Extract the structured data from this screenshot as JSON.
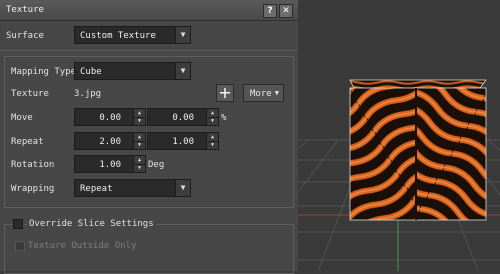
{
  "window": {
    "title": "Texture",
    "help_label": "?",
    "close_label": "✕"
  },
  "surface": {
    "label": "Surface",
    "value": "Custom Texture"
  },
  "mapping": {
    "label": "Mapping Type",
    "value": "Cube"
  },
  "texture": {
    "label": "Texture",
    "filename": "3.jpg",
    "add_label": "+",
    "more_label": "More"
  },
  "move": {
    "label": "Move",
    "x": "0.00",
    "y": "0.00",
    "unit": "%"
  },
  "repeat": {
    "label": "Repeat",
    "x": "2.00",
    "y": "1.00"
  },
  "rotation": {
    "label": "Rotation",
    "value": "1.00",
    "unit": "Deg"
  },
  "wrapping": {
    "label": "Wrapping",
    "value": "Repeat"
  },
  "override": {
    "label": "Override Slice Settings",
    "checked": false
  },
  "outside": {
    "label": "Texture Outside Only",
    "checked": false,
    "enabled": false
  },
  "colors": {
    "panel": "#474747",
    "field": "#2a2a2a",
    "viewport": "#3a3a3a",
    "texture_dark": "#1a0f06",
    "texture_orange": "#d9631f"
  },
  "icons": {
    "close": "close-icon",
    "help": "help-icon",
    "dropdown": "chevron-down-icon",
    "add": "plus-icon"
  }
}
